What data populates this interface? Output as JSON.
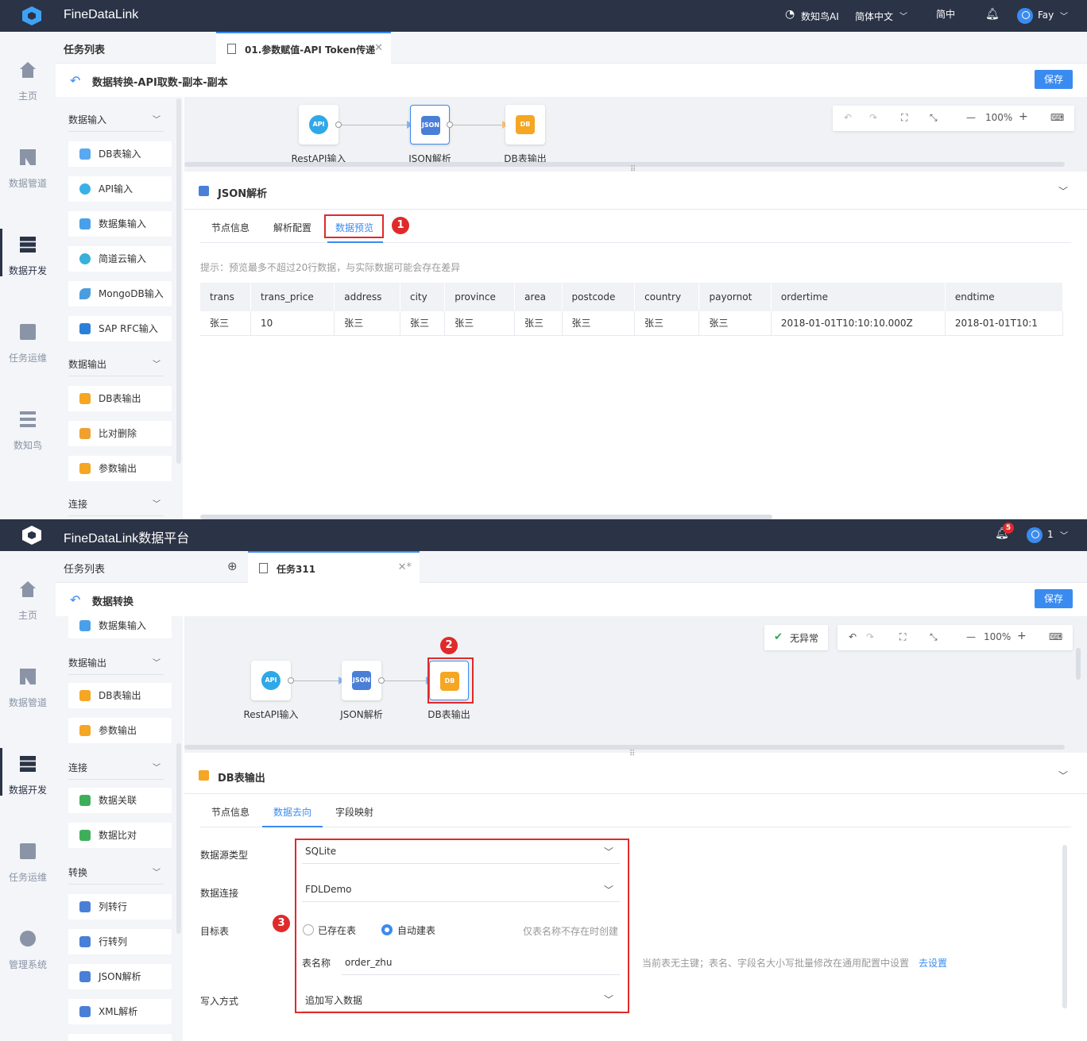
{
  "panel1": {
    "brand": "FineDataLink",
    "topbar": {
      "ai_label": "数知鸟AI",
      "lang": "简体中文",
      "region": "简中",
      "user": "Fay"
    },
    "nav": [
      "主页",
      "数据管道",
      "数据开发",
      "任务运维",
      "数知鸟"
    ],
    "tasklist_label": "任务列表",
    "open_tab": "01.参数赋值-API Token传递",
    "page_title": "数据转换-API取数-副本-副本",
    "save": "保存",
    "sidebar": {
      "groups": [
        "数据输入",
        "数据输出",
        "连接"
      ],
      "input_items": [
        "DB表输入",
        "API输入",
        "数据集输入",
        "简道云输入",
        "MongoDB输入",
        "SAP RFC输入"
      ],
      "output_items": [
        "DB表输出",
        "比对删除",
        "参数输出"
      ]
    },
    "nodes": [
      "RestAPI输入",
      "JSON解析",
      "DB表输出"
    ],
    "node_icons": [
      "API",
      "JSON",
      "DB"
    ],
    "zoom": "100%",
    "prop_title": "JSON解析",
    "tabs": [
      "节点信息",
      "解析配置",
      "数据预览"
    ],
    "badge": "1",
    "hint": "提示：预览最多不超过20行数据，与实际数据可能会存在差异",
    "table": {
      "columns": [
        "trans",
        "trans_price",
        "address",
        "city",
        "province",
        "area",
        "postcode",
        "country",
        "payornot",
        "ordertime",
        "endtime"
      ],
      "rows": [
        [
          "张三",
          "10",
          "张三",
          "张三",
          "张三",
          "张三",
          "张三",
          "张三",
          "张三",
          "2018-01-01T10:10:10.000Z",
          "2018-01-01T10:1"
        ]
      ]
    }
  },
  "panel2": {
    "brand": "FineDataLink数据平台",
    "notif_count": "5",
    "user": "1",
    "nav": [
      "主页",
      "数据管道",
      "数据开发",
      "任务运维",
      "管理系统"
    ],
    "tasklist_label": "任务列表",
    "open_tab": "任务311",
    "page_title": "数据转换",
    "save": "保存",
    "sidebar": {
      "top_item": "数据集输入",
      "groups": [
        "数据输出",
        "连接",
        "转换"
      ],
      "output_items": [
        "DB表输出",
        "参数输出"
      ],
      "join_items": [
        "数据关联",
        "数据比对"
      ],
      "transform_items": [
        "列转行",
        "行转列",
        "JSON解析",
        "XML解析"
      ]
    },
    "status": "无异常",
    "zoom": "100%",
    "nodes": [
      "RestAPI输入",
      "JSON解析",
      "DB表输出"
    ],
    "node_icons": [
      "API",
      "JSON",
      "DB"
    ],
    "badge2": "2",
    "prop_title": "DB表输出",
    "tabs": [
      "节点信息",
      "数据去向",
      "字段映射"
    ],
    "badge3": "3",
    "form": {
      "ds_type_label": "数据源类型",
      "ds_type": "SQLite",
      "conn_label": "数据连接",
      "conn": "FDLDemo",
      "target_label": "目标表",
      "radio_existing": "已存在表",
      "radio_auto": "自动建表",
      "auto_hint": "仅表名称不存在时创建",
      "table_name_label": "表名称",
      "table_name": "order_zhu",
      "pk_hint": "当前表无主键；表名、字段名大小写批量修改在通用配置中设置",
      "pk_link": "去设置",
      "write_label": "写入方式",
      "write_mode": "追加写入数据"
    }
  },
  "colors": {
    "accent": "#3a8bf0",
    "topbar": "#2b3346",
    "highlight": "#e02a2a"
  }
}
